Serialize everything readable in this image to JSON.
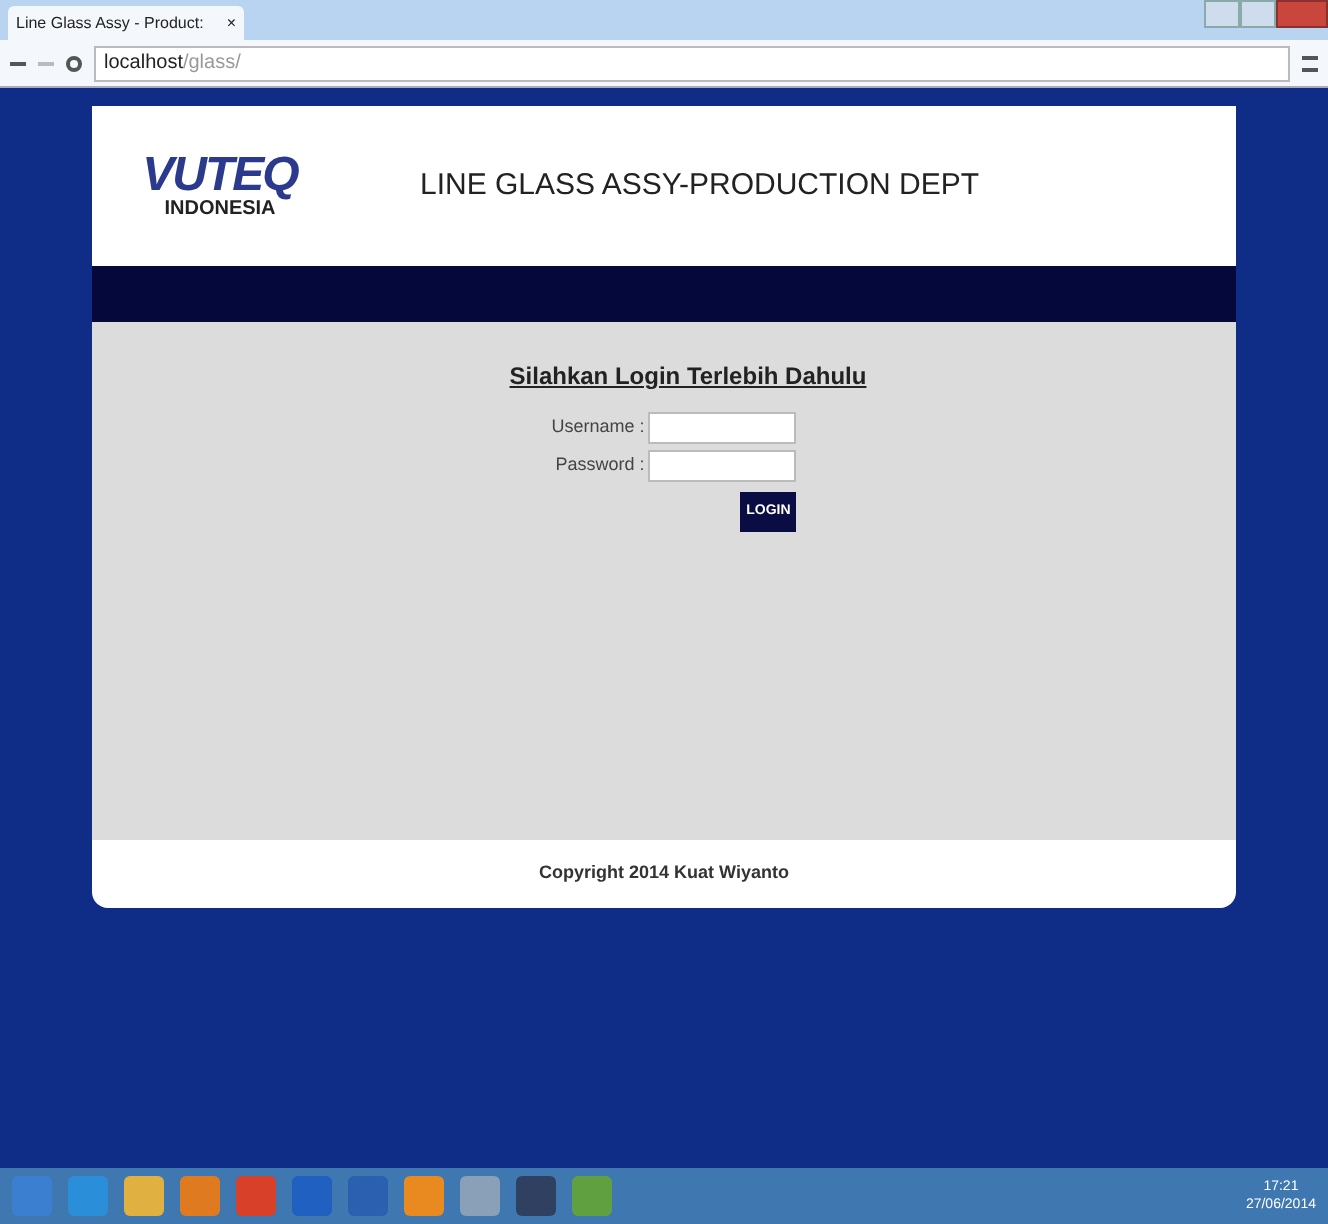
{
  "browser": {
    "tab_title": "Line Glass Assy - Product:",
    "tab_close": "×",
    "address": {
      "host": "localhost",
      "path": "/glass/"
    }
  },
  "header": {
    "logo_word": "VUTEQ",
    "logo_sub": "INDONESIA",
    "title": "LINE GLASS ASSY-PRODUCTION DEPT"
  },
  "login": {
    "heading": "Silahkan Login Terlebih Dahulu",
    "fields": [
      {
        "label": "Username :"
      },
      {
        "label": "Password :"
      }
    ],
    "button": "LOGIN"
  },
  "footer": "Copyright 2014 Kuat Wiyanto",
  "taskbar": {
    "apps": [
      {
        "color": "#3b7fd0"
      },
      {
        "color": "#2a8fd8"
      },
      {
        "color": "#e0b040"
      },
      {
        "color": "#e07a20"
      },
      {
        "color": "#d8402a"
      },
      {
        "color": "#2060c0"
      },
      {
        "color": "#2b5fb0"
      },
      {
        "color": "#e88a20"
      },
      {
        "color": "#8aa0b8"
      },
      {
        "color": "#304060"
      },
      {
        "color": "#60a040"
      }
    ],
    "time": "17:21",
    "date": "27/06/2014"
  }
}
